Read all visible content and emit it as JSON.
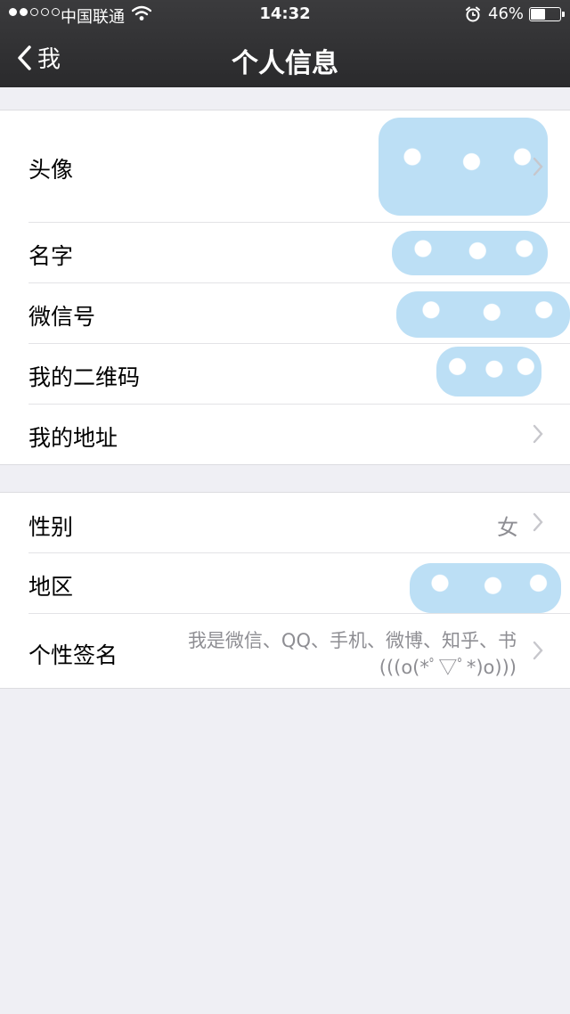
{
  "status_bar": {
    "carrier": "中国联通",
    "time": "14:32",
    "battery": "46%",
    "signal_bars": 2,
    "icons": [
      "wifi-icon",
      "alarm-icon",
      "battery-icon"
    ]
  },
  "nav": {
    "back_label": "我",
    "title": "个人信息"
  },
  "group1": {
    "rows": [
      {
        "label": "头像"
      },
      {
        "label": "名字"
      },
      {
        "label": "微信号"
      },
      {
        "label": "我的二维码"
      },
      {
        "label": "我的地址"
      }
    ]
  },
  "group2": {
    "rows": [
      {
        "label": "性别",
        "value": "女"
      },
      {
        "label": "地区"
      },
      {
        "label": "个性签名",
        "value_line1": "我是微信、QQ、手机、微博、知乎、书",
        "value_line2": "(((o(*ﾟ▽ﾟ*)o)))"
      }
    ]
  },
  "colors": {
    "nav_bg": "#2f2f31",
    "page_bg": "#efeff4",
    "secondary_text": "#8e8e93",
    "mask": "#bcdff5"
  }
}
